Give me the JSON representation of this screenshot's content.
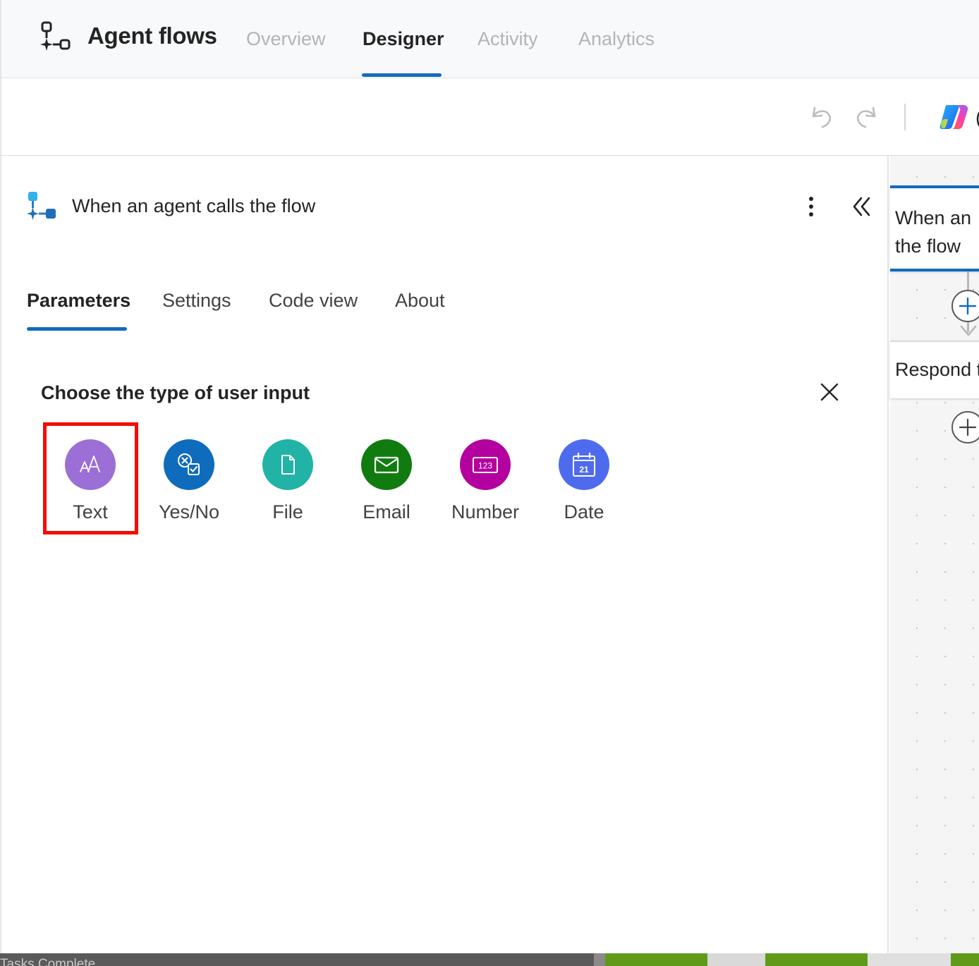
{
  "app": {
    "title": "Agent flows",
    "nav_tabs": [
      {
        "label": "Overview",
        "active": false
      },
      {
        "label": "Designer",
        "active": true
      },
      {
        "label": "Activity",
        "active": false
      },
      {
        "label": "Analytics",
        "active": false
      }
    ]
  },
  "toolbar": {
    "undo_icon": "undo-icon",
    "redo_icon": "redo-icon",
    "copilot_icon": "copilot-icon",
    "copilot_partial_label": "("
  },
  "panel": {
    "title": "When an agent calls the flow",
    "tabs": [
      {
        "label": "Parameters",
        "active": true
      },
      {
        "label": "Settings",
        "active": false
      },
      {
        "label": "Code view",
        "active": false
      },
      {
        "label": "About",
        "active": false
      }
    ],
    "input_chooser": {
      "title": "Choose the type of user input",
      "selected": "Text",
      "options": [
        {
          "label": "Text",
          "color": "#9b6fd6",
          "icon": "text-format-icon"
        },
        {
          "label": "Yes/No",
          "color": "#0f6cbd",
          "icon": "yes-no-icon"
        },
        {
          "label": "File",
          "color": "#20b3a6",
          "icon": "file-icon"
        },
        {
          "label": "Email",
          "color": "#107c10",
          "icon": "email-icon"
        },
        {
          "label": "Number",
          "color": "#b4009e",
          "icon": "number-icon"
        },
        {
          "label": "Date",
          "color": "#4f6bed",
          "icon": "calendar-icon"
        }
      ]
    },
    "highlight_color": "#f40c02"
  },
  "canvas": {
    "trigger_node_lines": [
      "When an",
      "the flow"
    ],
    "respond_node_text": "Respond t"
  },
  "bottom_strip": {
    "text": "Tasks Complete"
  },
  "colors": {
    "accent": "#0f6cbd"
  }
}
